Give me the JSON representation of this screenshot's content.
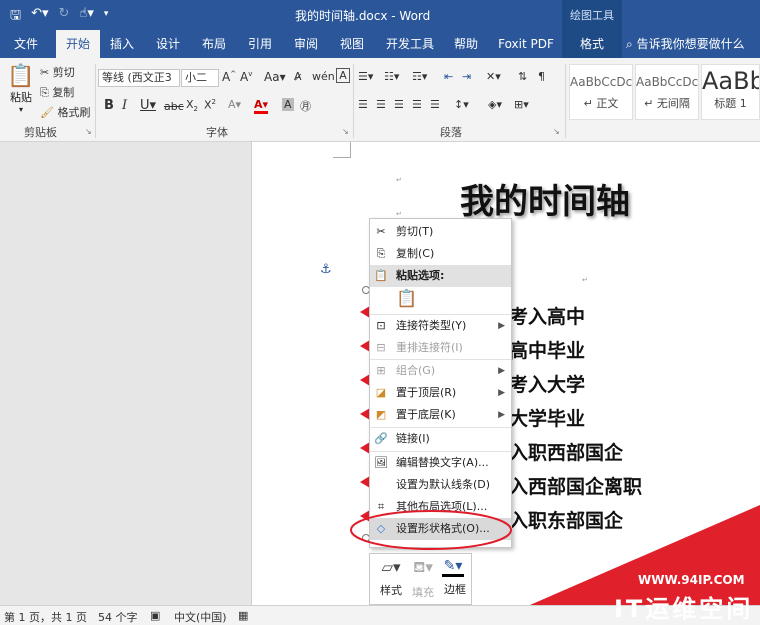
{
  "titlebar": {
    "title": "我的时间轴.docx - Word",
    "context_group": "绘图工具"
  },
  "tabs": [
    {
      "label": "文件"
    },
    {
      "label": "开始"
    },
    {
      "label": "插入"
    },
    {
      "label": "设计"
    },
    {
      "label": "布局"
    },
    {
      "label": "引用"
    },
    {
      "label": "审阅"
    },
    {
      "label": "视图"
    },
    {
      "label": "开发工具"
    },
    {
      "label": "帮助"
    },
    {
      "label": "Foxit PDF"
    },
    {
      "label": "格式"
    }
  ],
  "tell_me": "告诉我你想要做什么",
  "ribbon": {
    "clipboard": {
      "paste": "粘贴",
      "cut": "剪切",
      "copy": "复制",
      "format_painter": "格式刷",
      "label": "剪贴板"
    },
    "font": {
      "font_name": "等线 (西文正3",
      "font_size": "小二",
      "label": "字体"
    },
    "paragraph": {
      "label": "段落"
    },
    "styles": [
      {
        "sample": "AaBbCcDc",
        "name": "正文"
      },
      {
        "sample": "AaBbCcDc",
        "name": "无间隔"
      },
      {
        "sample": "AaBb",
        "name": "标题 1"
      }
    ]
  },
  "document": {
    "heading": "我的时间轴",
    "items": [
      "考入高中",
      "高中毕业",
      "考入大学",
      "大学毕业",
      "入职西部国企",
      "入西部国企离职",
      "入职东部国企"
    ]
  },
  "context_menu": {
    "items": [
      {
        "label": "剪切(T)",
        "icon": "scissors-icon"
      },
      {
        "label": "复制(C)",
        "icon": "copy-icon"
      },
      {
        "label": "粘贴选项:",
        "icon": "paste-icon"
      },
      {
        "label": "连接符类型(Y)",
        "icon": "connector-icon"
      },
      {
        "label": "重排连接符(I)",
        "icon": "reroute-icon"
      },
      {
        "label": "组合(G)",
        "icon": "group-icon"
      },
      {
        "label": "置于顶层(R)",
        "icon": "bring-front-icon"
      },
      {
        "label": "置于底层(K)",
        "icon": "send-back-icon"
      },
      {
        "label": "链接(I)",
        "icon": "link-icon"
      },
      {
        "label": "编辑替换文字(A)...",
        "icon": "alt-text-icon"
      },
      {
        "label": "设置为默认线条(D)",
        "icon": ""
      },
      {
        "label": "其他布局选项(L)...",
        "icon": "layout-icon"
      },
      {
        "label": "设置形状格式(O)...",
        "icon": "format-shape-icon"
      }
    ]
  },
  "mini_toolbar": {
    "style": "样式",
    "fill": "填充",
    "outline": "边框"
  },
  "statusbar": {
    "page": "第 1 页，共 1 页",
    "words": "54 个字",
    "lang": "中文(中国)"
  },
  "watermark": {
    "url": "WWW.94IP.COM",
    "text": "IT运维空间"
  }
}
